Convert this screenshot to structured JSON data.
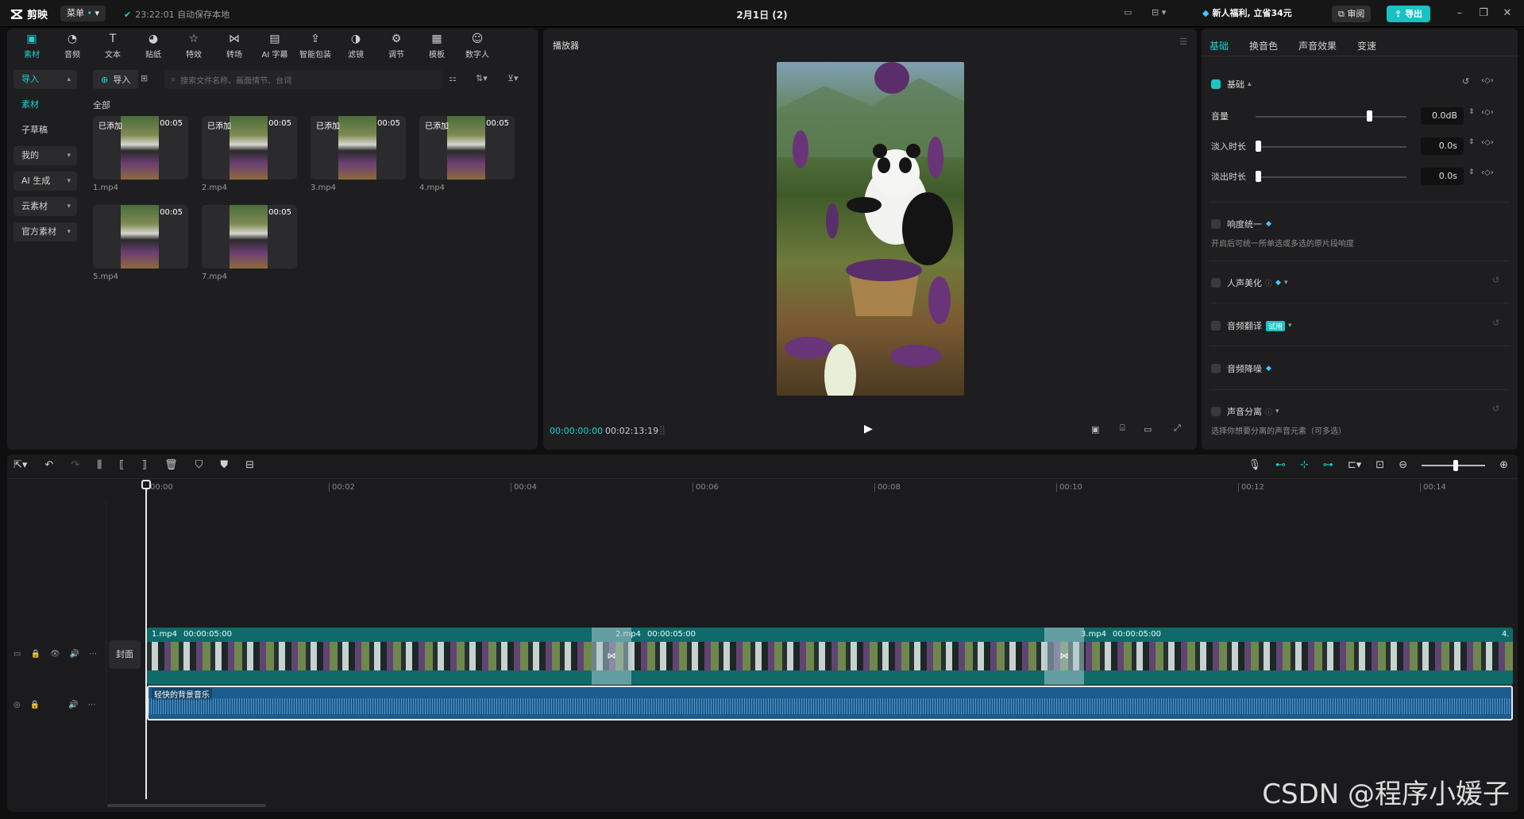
{
  "app": {
    "logo": "剪映",
    "menu_label": "菜单",
    "save_status": "23:22:01 自动保存本地",
    "project_title": "2月1日 (2)",
    "promo": "新人福利, 立省34元",
    "review_label": "审阅",
    "export_label": "导出"
  },
  "tools": [
    {
      "label": "素材",
      "icon": "media-icon"
    },
    {
      "label": "音频",
      "icon": "audio-icon"
    },
    {
      "label": "文本",
      "icon": "text-icon"
    },
    {
      "label": "贴纸",
      "icon": "sticker-icon"
    },
    {
      "label": "特效",
      "icon": "effects-icon"
    },
    {
      "label": "转场",
      "icon": "transition-icon"
    },
    {
      "label": "AI 字幕",
      "icon": "ai-subtitle-icon"
    },
    {
      "label": "智能包装",
      "icon": "smart-pack-icon"
    },
    {
      "label": "滤镜",
      "icon": "filter-icon"
    },
    {
      "label": "调节",
      "icon": "adjust-icon"
    },
    {
      "label": "模板",
      "icon": "template-icon"
    },
    {
      "label": "数字人",
      "icon": "avatar-icon"
    }
  ],
  "sidebar": {
    "items": [
      {
        "label": "导入"
      },
      {
        "label": "素材"
      },
      {
        "label": "子草稿"
      },
      {
        "label": "我的"
      },
      {
        "label": "AI 生成"
      },
      {
        "label": "云素材"
      },
      {
        "label": "官方素材"
      }
    ]
  },
  "media": {
    "import_label": "导入",
    "search_placeholder": "搜索文件名称、画面情节、台词",
    "section": "全部",
    "items": [
      {
        "name": "1.mp4",
        "tag": "已添加",
        "duration": "00:05"
      },
      {
        "name": "2.mp4",
        "tag": "已添加",
        "duration": "00:05"
      },
      {
        "name": "3.mp4",
        "tag": "已添加",
        "duration": "00:05"
      },
      {
        "name": "4.mp4",
        "tag": "已添加",
        "duration": "00:05"
      },
      {
        "name": "5.mp4",
        "tag": "",
        "duration": "00:05"
      },
      {
        "name": "7.mp4",
        "tag": "",
        "duration": "00:05"
      }
    ]
  },
  "player": {
    "title": "播放器",
    "current_time": "00:00:00:00",
    "total_time": "00:02:13:19"
  },
  "props": {
    "tabs": [
      "基础",
      "换音色",
      "声音效果",
      "变速"
    ],
    "section_basic": "基础",
    "volume_label": "音量",
    "volume_value": "0.0dB",
    "volume_level": 0.75,
    "fadein_label": "淡入时长",
    "fadein_value": "0.0s",
    "fadeout_label": "淡出时长",
    "fadeout_value": "0.0s",
    "loudness_label": "响度统一",
    "loudness_hint": "开启后可统一所单选或多选的原片段响度",
    "voice_enhance_label": "人声美化",
    "translate_label": "音频翻译",
    "translate_badge": "试用",
    "denoise_label": "音频降噪",
    "separate_label": "声音分离",
    "separate_hint": "选择你想要分离的声音元素（可多选）"
  },
  "timeline": {
    "ruler": [
      "00:00",
      "00:02",
      "00:04",
      "00:06",
      "00:08",
      "00:10",
      "00:12",
      "00:14"
    ],
    "cover_label": "封面",
    "clips": [
      {
        "name": "1.mp4",
        "duration": "00:00:05:00"
      },
      {
        "name": "2.mp4",
        "duration": "00:00:05:00"
      },
      {
        "name": "3.mp4",
        "duration": "00:00:05:00"
      },
      {
        "name": "4."
      }
    ],
    "audio_label": "轻快的背景音乐"
  },
  "watermark": "CSDN @程序小媛子",
  "colors": {
    "accent": "#20d0d2",
    "clip": "#0f6a6a",
    "audio": "#1c5c8c"
  }
}
